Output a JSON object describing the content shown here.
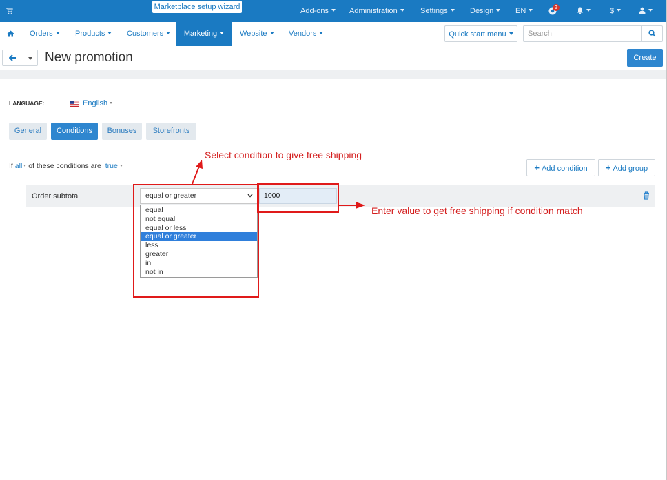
{
  "topbar": {
    "wizard_label": "Marketplace setup wizard",
    "items": [
      "Add-ons",
      "Administration",
      "Settings",
      "Design",
      "EN"
    ],
    "notification_count": "2",
    "currency": "$"
  },
  "mainnav": {
    "items": [
      "Orders",
      "Products",
      "Customers",
      "Marketing",
      "Website",
      "Vendors"
    ],
    "active": "Marketing",
    "quick_start": "Quick start menu",
    "search_placeholder": "Search"
  },
  "titlebar": {
    "title": "New promotion",
    "create_label": "Create"
  },
  "language": {
    "label": "LANGUAGE:",
    "value": "English"
  },
  "tabs": [
    "General",
    "Conditions",
    "Bonuses",
    "Storefronts"
  ],
  "active_tab": "Conditions",
  "conditions_line": {
    "prefix": "If",
    "all": "all",
    "middle": "of these conditions are",
    "truth": "true"
  },
  "buttons": {
    "add_condition": "Add condition",
    "add_group": "Add group"
  },
  "condition": {
    "name": "Order subtotal",
    "operator_selected": "equal or greater",
    "operator_options": [
      "equal",
      "not equal",
      "equal or less",
      "equal or greater",
      "less",
      "greater",
      "in",
      "not in"
    ],
    "value": "1000"
  },
  "annotations": {
    "select_note": "Select condition to give free shipping",
    "value_note": "Enter value to get free shipping if condition match"
  },
  "colors": {
    "primary": "#1a7ac2",
    "button_blue": "#2e86cf",
    "annotation_red": "#e01a1a",
    "selected_option": "#2f7fdb"
  }
}
